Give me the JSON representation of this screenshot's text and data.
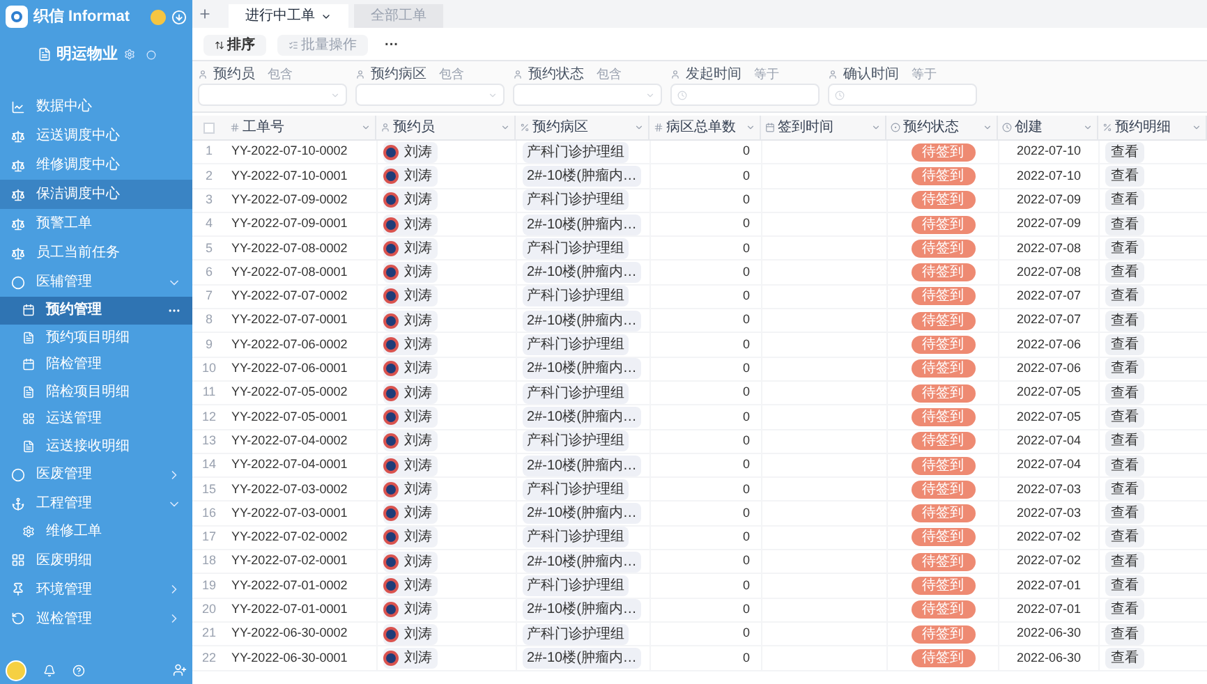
{
  "app": {
    "name": "织信 Informat",
    "workspace": "明运物业"
  },
  "sidebar": {
    "items": [
      {
        "label": "数据中心",
        "kind": "link",
        "selected": false
      },
      {
        "label": "运送调度中心",
        "kind": "link",
        "selected": false
      },
      {
        "label": "维修调度中心",
        "kind": "link",
        "selected": false
      },
      {
        "label": "保洁调度中心",
        "kind": "link",
        "selected": true
      },
      {
        "label": "预警工单",
        "kind": "link",
        "selected": false
      },
      {
        "label": "员工当前任务",
        "kind": "link",
        "selected": false
      },
      {
        "label": "医辅管理",
        "kind": "group",
        "selected": false,
        "expanded": true,
        "children": [
          {
            "label": "预约管理",
            "selected": true
          },
          {
            "label": "预约项目明细",
            "selected": false
          },
          {
            "label": "陪检管理",
            "selected": false
          },
          {
            "label": "陪检项目明细",
            "selected": false
          },
          {
            "label": "运送管理",
            "selected": false
          },
          {
            "label": "运送接收明细",
            "selected": false
          }
        ]
      },
      {
        "label": "医废管理",
        "kind": "group",
        "selected": false,
        "expanded": false
      },
      {
        "label": "工程管理",
        "kind": "group",
        "selected": false,
        "expanded": true,
        "children": [
          {
            "label": "维修工单",
            "selected": false
          }
        ]
      },
      {
        "label": "医废明细",
        "kind": "link",
        "selected": false
      },
      {
        "label": "环境管理",
        "kind": "group",
        "selected": false,
        "expanded": false
      },
      {
        "label": "巡检管理",
        "kind": "group",
        "selected": false,
        "expanded": false
      }
    ]
  },
  "tabs": [
    {
      "label": "进行中工单",
      "selected": true
    },
    {
      "label": "全部工单",
      "selected": false
    }
  ],
  "toolbar": {
    "sort": "排序",
    "batch": {
      "label": "批量操作",
      "disabled": true
    },
    "more": "···"
  },
  "filters": [
    {
      "label": "预约员",
      "op": "包含",
      "kind": "select"
    },
    {
      "label": "预约病区",
      "op": "包含",
      "kind": "select"
    },
    {
      "label": "预约状态",
      "op": "包含",
      "kind": "select"
    },
    {
      "label": "发起时间",
      "op": "等于",
      "kind": "date"
    },
    {
      "label": "确认时间",
      "op": "等于",
      "kind": "date"
    }
  ],
  "table": {
    "select_all": {
      "checked": false
    },
    "columns": [
      "工单号",
      "预约员",
      "预约病区",
      "病区总单数",
      "签到时间",
      "预约状态",
      "创建",
      "预约明细"
    ],
    "rows": [
      {
        "no": "1",
        "id": "YY-2022-07-10-0002",
        "person": "刘涛",
        "ward": "产科门诊护理组",
        "count": "0",
        "status": "待签到",
        "created": "2022-07-10",
        "detail": "查看"
      },
      {
        "no": "2",
        "id": "YY-2022-07-10-0001",
        "person": "刘涛",
        "ward": "2#-10楼(肿瘤内…",
        "count": "0",
        "status": "待签到",
        "created": "2022-07-10",
        "detail": "查看"
      },
      {
        "no": "3",
        "id": "YY-2022-07-09-0002",
        "person": "刘涛",
        "ward": "产科门诊护理组",
        "count": "0",
        "status": "待签到",
        "created": "2022-07-09",
        "detail": "查看"
      },
      {
        "no": "4",
        "id": "YY-2022-07-09-0001",
        "person": "刘涛",
        "ward": "2#-10楼(肿瘤内…",
        "count": "0",
        "status": "待签到",
        "created": "2022-07-09",
        "detail": "查看"
      },
      {
        "no": "5",
        "id": "YY-2022-07-08-0002",
        "person": "刘涛",
        "ward": "产科门诊护理组",
        "count": "0",
        "status": "待签到",
        "created": "2022-07-08",
        "detail": "查看"
      },
      {
        "no": "6",
        "id": "YY-2022-07-08-0001",
        "person": "刘涛",
        "ward": "2#-10楼(肿瘤内…",
        "count": "0",
        "status": "待签到",
        "created": "2022-07-08",
        "detail": "查看"
      },
      {
        "no": "7",
        "id": "YY-2022-07-07-0002",
        "person": "刘涛",
        "ward": "产科门诊护理组",
        "count": "0",
        "status": "待签到",
        "created": "2022-07-07",
        "detail": "查看"
      },
      {
        "no": "8",
        "id": "YY-2022-07-07-0001",
        "person": "刘涛",
        "ward": "2#-10楼(肿瘤内…",
        "count": "0",
        "status": "待签到",
        "created": "2022-07-07",
        "detail": "查看"
      },
      {
        "no": "9",
        "id": "YY-2022-07-06-0002",
        "person": "刘涛",
        "ward": "产科门诊护理组",
        "count": "0",
        "status": "待签到",
        "created": "2022-07-06",
        "detail": "查看"
      },
      {
        "no": "10",
        "id": "YY-2022-07-06-0001",
        "person": "刘涛",
        "ward": "2#-10楼(肿瘤内…",
        "count": "0",
        "status": "待签到",
        "created": "2022-07-06",
        "detail": "查看"
      },
      {
        "no": "11",
        "id": "YY-2022-07-05-0002",
        "person": "刘涛",
        "ward": "产科门诊护理组",
        "count": "0",
        "status": "待签到",
        "created": "2022-07-05",
        "detail": "查看"
      },
      {
        "no": "12",
        "id": "YY-2022-07-05-0001",
        "person": "刘涛",
        "ward": "2#-10楼(肿瘤内…",
        "count": "0",
        "status": "待签到",
        "created": "2022-07-05",
        "detail": "查看"
      },
      {
        "no": "13",
        "id": "YY-2022-07-04-0002",
        "person": "刘涛",
        "ward": "产科门诊护理组",
        "count": "0",
        "status": "待签到",
        "created": "2022-07-04",
        "detail": "查看"
      },
      {
        "no": "14",
        "id": "YY-2022-07-04-0001",
        "person": "刘涛",
        "ward": "2#-10楼(肿瘤内…",
        "count": "0",
        "status": "待签到",
        "created": "2022-07-04",
        "detail": "查看"
      },
      {
        "no": "15",
        "id": "YY-2022-07-03-0002",
        "person": "刘涛",
        "ward": "产科门诊护理组",
        "count": "0",
        "status": "待签到",
        "created": "2022-07-03",
        "detail": "查看"
      },
      {
        "no": "16",
        "id": "YY-2022-07-03-0001",
        "person": "刘涛",
        "ward": "2#-10楼(肿瘤内…",
        "count": "0",
        "status": "待签到",
        "created": "2022-07-03",
        "detail": "查看"
      },
      {
        "no": "17",
        "id": "YY-2022-07-02-0002",
        "person": "刘涛",
        "ward": "产科门诊护理组",
        "count": "0",
        "status": "待签到",
        "created": "2022-07-02",
        "detail": "查看"
      },
      {
        "no": "18",
        "id": "YY-2022-07-02-0001",
        "person": "刘涛",
        "ward": "2#-10楼(肿瘤内…",
        "count": "0",
        "status": "待签到",
        "created": "2022-07-02",
        "detail": "查看"
      },
      {
        "no": "19",
        "id": "YY-2022-07-01-0002",
        "person": "刘涛",
        "ward": "产科门诊护理组",
        "count": "0",
        "status": "待签到",
        "created": "2022-07-01",
        "detail": "查看"
      },
      {
        "no": "20",
        "id": "YY-2022-07-01-0001",
        "person": "刘涛",
        "ward": "2#-10楼(肿瘤内…",
        "count": "0",
        "status": "待签到",
        "created": "2022-07-01",
        "detail": "查看"
      },
      {
        "no": "21",
        "id": "YY-2022-06-30-0002",
        "person": "刘涛",
        "ward": "产科门诊护理组",
        "count": "0",
        "status": "待签到",
        "created": "2022-06-30",
        "detail": "查看"
      },
      {
        "no": "22",
        "id": "YY-2022-06-30-0001",
        "person": "刘涛",
        "ward": "2#-10楼(肿瘤内…",
        "count": "0",
        "status": "待签到",
        "created": "2022-06-30",
        "detail": "查看"
      }
    ]
  }
}
